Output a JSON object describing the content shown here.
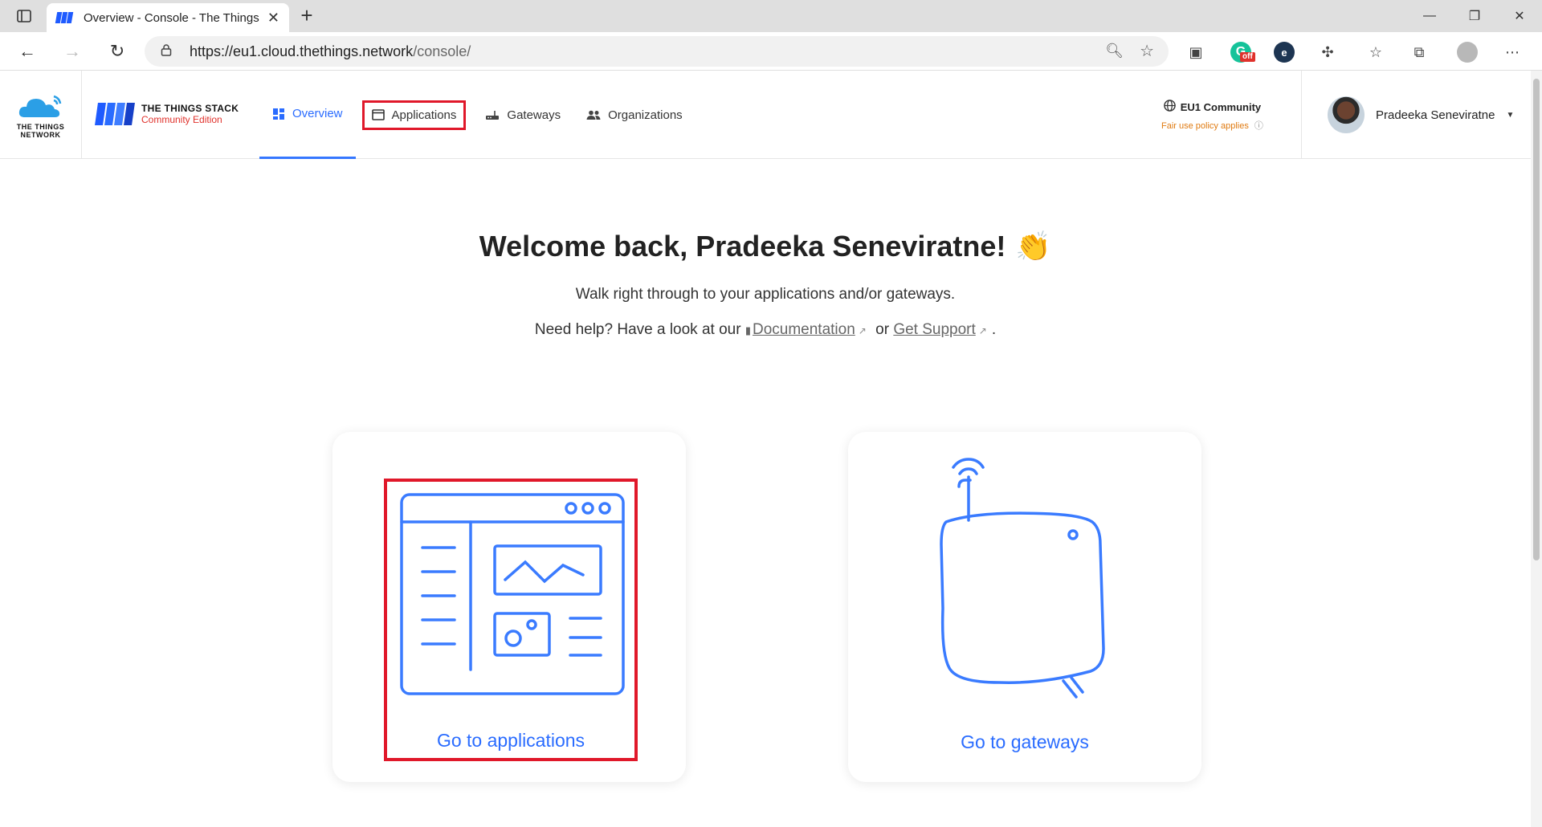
{
  "browser": {
    "tab_title": "Overview - Console - The Things Stack",
    "url_host": "https://eu1.cloud.thethings.network",
    "url_path": "/console/",
    "ext_badge": "off"
  },
  "brand": {
    "ttn_label_line1": "THE THINGS",
    "ttn_label_line2": "NETWORK",
    "tts_title": "THE THINGS STACK",
    "tts_subtitle": "Community Edition"
  },
  "nav": {
    "overview": "Overview",
    "applications": "Applications",
    "gateways": "Gateways",
    "organizations": "Organizations"
  },
  "region": {
    "name": "EU1 Community",
    "policy": "Fair use policy applies"
  },
  "user": {
    "name": "Pradeeka Seneviratne"
  },
  "main": {
    "welcome": "Welcome back, Pradeeka Seneviratne!",
    "wave_emoji": "👏",
    "subtitle": "Walk right through to your applications and/or gateways.",
    "help_prefix": "Need help? Have a look at our",
    "documentation": "Documentation",
    "or_text": "or",
    "get_support": "Get Support",
    "period": ".",
    "cards": {
      "applications_cta": "Go to applications",
      "gateways_cta": "Go to gateways"
    }
  },
  "colors": {
    "accent": "#2a6cff",
    "highlight_box": "#e0182a",
    "policy_orange": "#e07b12"
  }
}
